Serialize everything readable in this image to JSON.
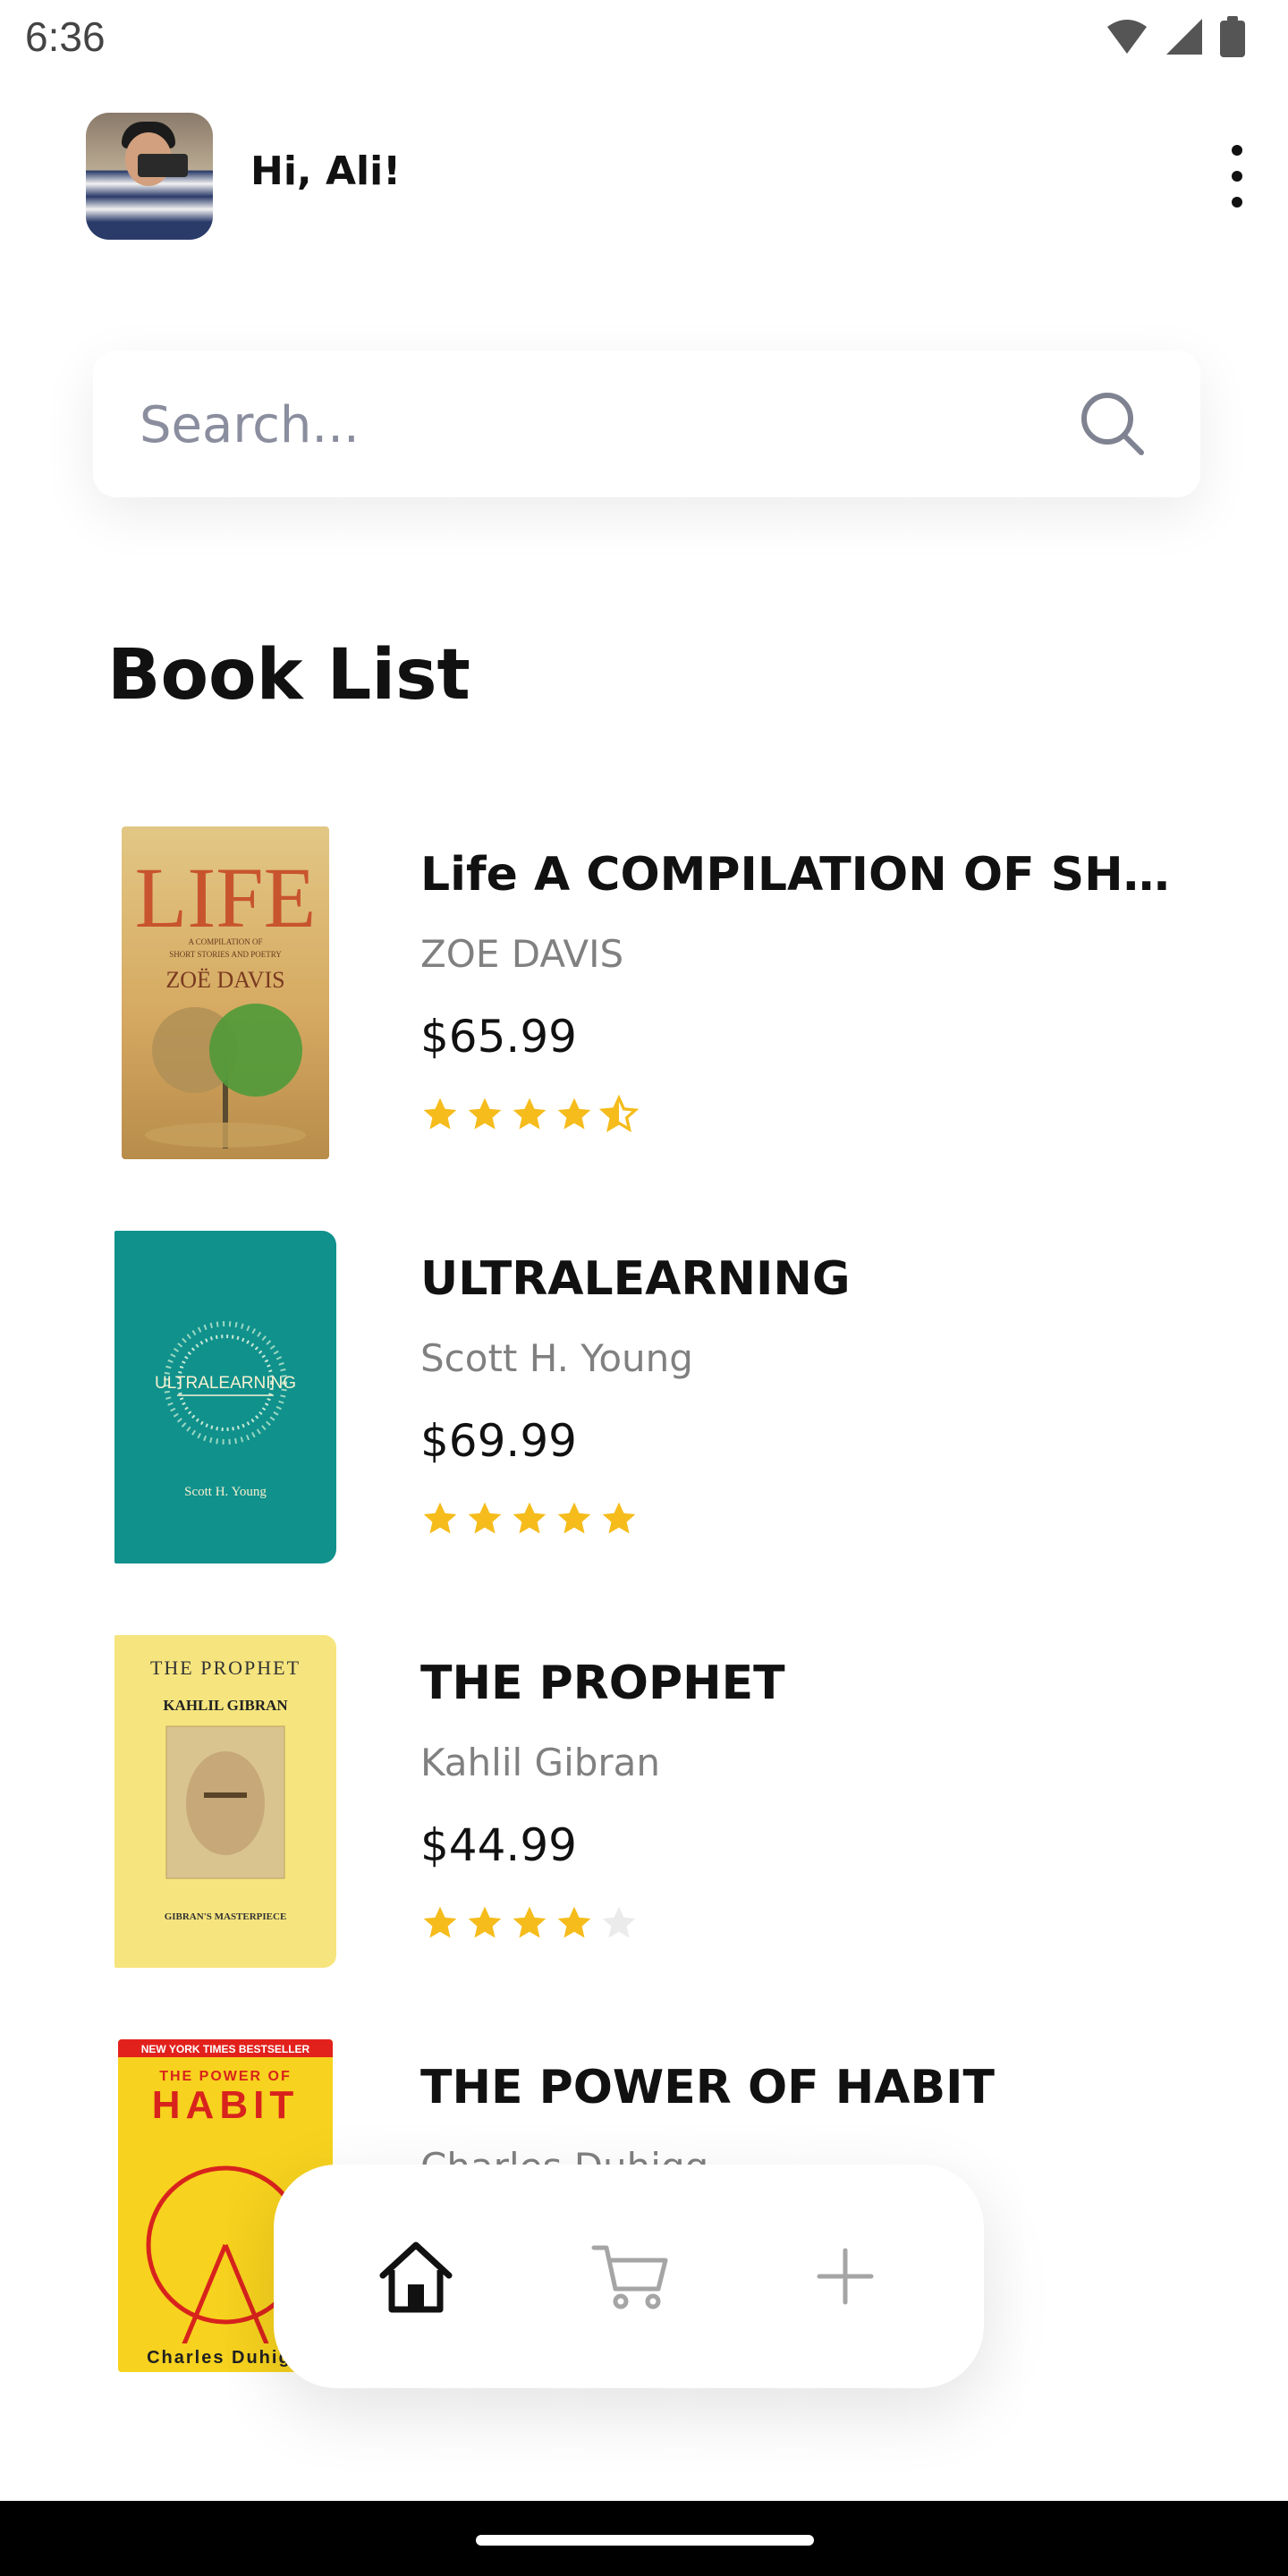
{
  "status_bar": {
    "time": "6:36"
  },
  "header": {
    "greeting": "Hi, Ali!"
  },
  "search": {
    "placeholder": "Search..."
  },
  "section": {
    "title": "Book List"
  },
  "books": [
    {
      "title": "Life A COMPILATION OF SHOR...",
      "author": "ZOE DAVIS",
      "price": "$65.99",
      "rating": 4.5,
      "cover": {
        "title": "LIFE",
        "subtitle": "A COMPILATION OF SHORT STORIES AND POETRY",
        "author": "ZOË DAVIS"
      }
    },
    {
      "title": "ULTRALEARNING",
      "author": "Scott H. Young",
      "price": "$69.99",
      "rating": 5,
      "cover": {
        "title": "ULTRALEARNING",
        "author": "Scott H. Young"
      }
    },
    {
      "title": "THE PROPHET",
      "author": "Kahlil Gibran",
      "price": "$44.99",
      "rating": 4,
      "cover": {
        "title": "THE PROPHET",
        "author": "KAHLIL GIBRAN",
        "tagline": "GIBRAN'S MASTERPIECE"
      }
    },
    {
      "title": "THE POWER OF HABIT",
      "author": "Charles Duhigg",
      "price": "",
      "rating": null,
      "cover": {
        "banner": "NEW YORK TIMES BESTSELLER",
        "top": "THE POWER OF",
        "title": "HABIT",
        "author": "Charles Duhigg"
      }
    }
  ],
  "bottom_nav": [
    {
      "name": "home",
      "icon": "home-icon",
      "active": true
    },
    {
      "name": "cart",
      "icon": "cart-icon",
      "active": false
    },
    {
      "name": "add",
      "icon": "plus-icon",
      "active": false
    }
  ],
  "colors": {
    "star": "#F5BC1C",
    "star_empty": "#EBEBEB",
    "active_icon": "#111111",
    "inactive_icon": "#A5A5A5"
  }
}
